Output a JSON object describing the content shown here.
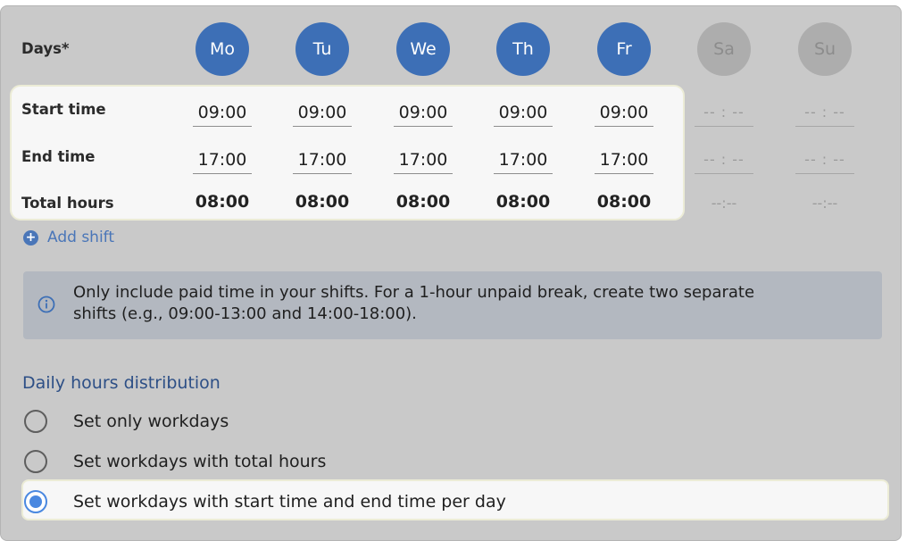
{
  "days_label": "Days*",
  "days": [
    {
      "abbr": "Mo",
      "selected": true
    },
    {
      "abbr": "Tu",
      "selected": true
    },
    {
      "abbr": "We",
      "selected": true
    },
    {
      "abbr": "Th",
      "selected": true
    },
    {
      "abbr": "Fr",
      "selected": true
    },
    {
      "abbr": "Sa",
      "selected": false
    },
    {
      "abbr": "Su",
      "selected": false
    }
  ],
  "rows": {
    "start_label": "Start time",
    "end_label": "End time",
    "total_label": "Total hours"
  },
  "start_times": [
    "09:00",
    "09:00",
    "09:00",
    "09:00",
    "09:00",
    "-- : --",
    "-- : --"
  ],
  "end_times": [
    "17:00",
    "17:00",
    "17:00",
    "17:00",
    "17:00",
    "-- : --",
    "-- : --"
  ],
  "totals": [
    "08:00",
    "08:00",
    "08:00",
    "08:00",
    "08:00",
    "--:--",
    "--:--"
  ],
  "add_shift_label": "Add shift",
  "info": {
    "line1": "Only include paid time in your shifts. For a 1-hour unpaid break, create two separate",
    "line2": "shifts (e.g., 09:00-13:00 and 14:00-18:00)."
  },
  "distribution": {
    "title": "Daily hours distribution",
    "options": [
      {
        "label": "Set only workdays",
        "checked": false
      },
      {
        "label": "Set workdays with total hours",
        "checked": false
      },
      {
        "label": "Set workdays with start time and end time per day",
        "checked": true
      }
    ]
  },
  "colors": {
    "accent": "#3d6fb6",
    "radio_selected": "#4a88e0",
    "section_title": "#2d4f86"
  }
}
